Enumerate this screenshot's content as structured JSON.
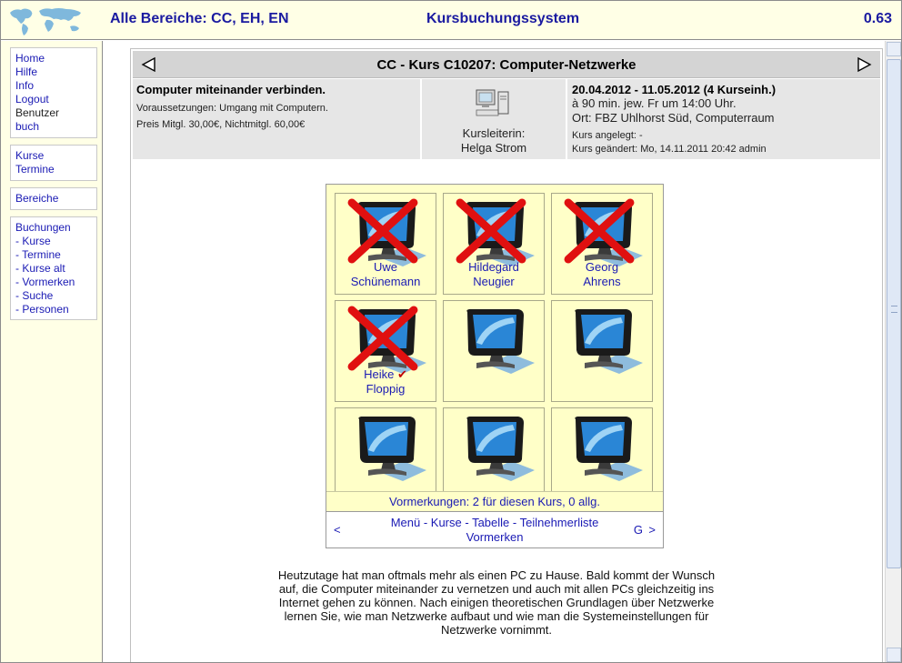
{
  "header": {
    "area_label": "Alle Bereiche: CC, EH, EN",
    "system_title": "Kursbuchungssystem",
    "version": "0.63",
    "logo_icon": "world-map-icon"
  },
  "sidebar": {
    "group1": [
      {
        "label": "Home",
        "link": true
      },
      {
        "label": "Hilfe",
        "link": true
      },
      {
        "label": "Info",
        "link": true
      },
      {
        "label": "Logout",
        "link": true
      },
      {
        "label": "Benutzer",
        "link": false
      },
      {
        "label": "buch",
        "link": true
      }
    ],
    "group2": [
      {
        "label": "Kurse"
      },
      {
        "label": "Termine"
      }
    ],
    "group3": [
      {
        "label": "Bereiche"
      }
    ],
    "group4": [
      {
        "label": "Buchungen"
      },
      {
        "label": "- Kurse"
      },
      {
        "label": "- Termine"
      },
      {
        "label": "- Kurse alt"
      },
      {
        "label": "- Vormerken"
      },
      {
        "label": "- Suche"
      },
      {
        "label": "- Personen"
      }
    ]
  },
  "course": {
    "title": "CC - Kurs C10207: Computer-Netzwerke",
    "headline": "Computer miteinander verbinden.",
    "prerequisites": "Voraussetzungen: Umgang mit Computern.",
    "price": "Preis Mitgl. 30,00€, Nichtmitgl. 60,00€",
    "leader_label": "Kursleiterin:",
    "leader_name": "Helga Strom",
    "dates": "20.04.2012 - 11.05.2012 (4 Kurseinh.)",
    "schedule": "à 90 min. jew. Fr um 14:00 Uhr.",
    "location": "Ort: FBZ Uhlhorst Süd, Computerraum",
    "created": "Kurs angelegt: -",
    "modified": "Kurs geändert: Mo, 14.11.2011 20:42 admin"
  },
  "seats": [
    {
      "first": "Uwe",
      "last": "Schünemann",
      "booked": true,
      "own": false
    },
    {
      "first": "Hildegard",
      "last": "Neugier",
      "booked": true,
      "own": false
    },
    {
      "first": "Georg",
      "last": "Ahrens",
      "booked": true,
      "own": false
    },
    {
      "first": "Heike",
      "last": "Floppig",
      "booked": true,
      "own": true
    },
    {
      "first": "",
      "last": "",
      "booked": false,
      "own": false
    },
    {
      "first": "",
      "last": "",
      "booked": false,
      "own": false
    },
    {
      "first": "",
      "last": "",
      "booked": false,
      "own": false
    },
    {
      "first": "",
      "last": "",
      "booked": false,
      "own": false
    },
    {
      "first": "",
      "last": "",
      "booked": false,
      "own": false
    }
  ],
  "seat_grid": {
    "check_mark": "✔",
    "reservations": "Vormerkungen: 2 für diesen Kurs, 0 allg.",
    "nav_prev": "<",
    "nav_next": ">",
    "nav_g": "G",
    "nav_links": [
      "Menü",
      "Kurse",
      "Tabelle",
      "Teilnehmerliste",
      "Vormerken"
    ]
  },
  "description": "Heutzutage hat man oftmals mehr als einen PC zu Hause. Bald kommt der Wunsch auf, die Computer miteinander zu vernetzen und auch mit allen PCs gleichzeitig ins Internet gehen zu können. Nach einigen theoretischen Grundlagen über Netzwerke lernen Sie, wie man Netzwerke aufbaut und wie man die Systemeinstellungen für Netzwerke vornimmt.",
  "colors": {
    "accent_link": "#1a1ab4",
    "panel_yellow": "#ffffc8",
    "cross_red": "#e01010"
  }
}
